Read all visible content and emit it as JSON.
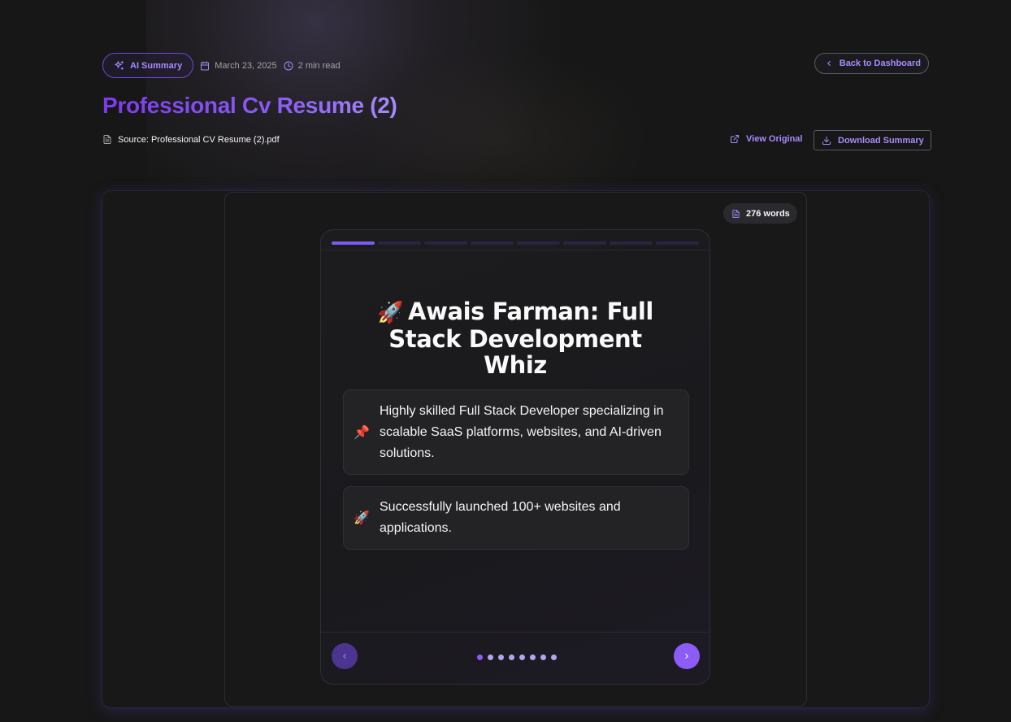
{
  "header": {
    "badge_label": "AI Summary",
    "date": "March 23, 2025",
    "read_time": "2 min read",
    "back_label": "Back to Dashboard"
  },
  "document": {
    "title": "Professional Cv Resume (2)",
    "source": "Source: Professional CV Resume (2).pdf",
    "view_original_label": "View Original",
    "download_label": "Download Summary",
    "word_count": "276 words"
  },
  "slide": {
    "heading_emoji": "🚀",
    "heading": "Awais Farman: Full Stack Development Whiz",
    "points": [
      {
        "emoji": "📌",
        "text": "Highly skilled Full Stack Developer specializing in scalable SaaS platforms, websites, and AI-driven solutions."
      },
      {
        "emoji": "🚀",
        "text": "Successfully launched 100+ websites and applications."
      }
    ],
    "total_slides": 8,
    "current_slide": 1
  },
  "icons": {
    "badge": "sparkles-icon",
    "date": "calendar-icon",
    "read_time": "clock-icon",
    "back": "chevron-left-icon",
    "source": "file-text-icon",
    "view_original": "external-link-icon",
    "download": "download-icon",
    "words": "file-text-icon",
    "prev": "chevron-left-icon",
    "next": "chevron-right-icon"
  },
  "colors": {
    "background": "#171717",
    "accent": "#8b5cf6",
    "accent_light": "#a78bfa",
    "title_gradient_start": "#7c3aed"
  }
}
